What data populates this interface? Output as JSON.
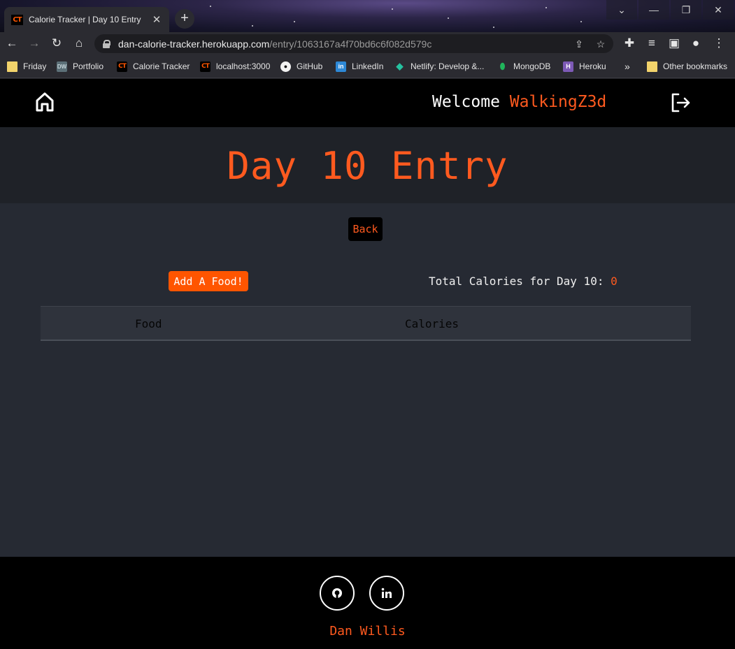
{
  "browser": {
    "tab_title": "Calorie Tracker | Day 10 Entry",
    "tab_favicon": "CT",
    "new_tab": "+",
    "url_host": "dan-calorie-tracker.herokuapp.com",
    "url_path": "/entry/1063167a4f70bd6c6f082d579c",
    "bookmarks": [
      {
        "label": "Friday",
        "icon": "folder-icon"
      },
      {
        "label": "Portfolio",
        "icon": "dw-icon",
        "icon_text": "DW"
      },
      {
        "label": "Calorie Tracker",
        "icon": "ct-icon",
        "icon_text": "CT"
      },
      {
        "label": "localhost:3000",
        "icon": "ct-icon",
        "icon_text": "CT"
      },
      {
        "label": "GitHub",
        "icon": "github-icon"
      },
      {
        "label": "LinkedIn",
        "icon": "linkedin-icon",
        "icon_text": "in"
      },
      {
        "label": "Netlify: Develop &...",
        "icon": "netlify-icon"
      },
      {
        "label": "MongoDB",
        "icon": "mongodb-icon"
      },
      {
        "label": "Heroku",
        "icon": "heroku-icon",
        "icon_text": "H"
      }
    ],
    "overflow": "»",
    "other_bookmarks": "Other bookmarks"
  },
  "header": {
    "welcome": "Welcome",
    "username": "WalkingZ3d"
  },
  "page": {
    "title": "Day 10 Entry",
    "back_label": "Back",
    "add_food_label": "Add A Food!",
    "total_label": "Total Calories for Day 10:",
    "total_value": "0"
  },
  "table": {
    "columns": [
      "Food",
      "Calories"
    ],
    "rows": []
  },
  "footer": {
    "author": "Dan Willis"
  },
  "colors": {
    "accent": "#ff5a1f",
    "button": "#ff5500",
    "background": "#262a33",
    "header": "#000000"
  }
}
